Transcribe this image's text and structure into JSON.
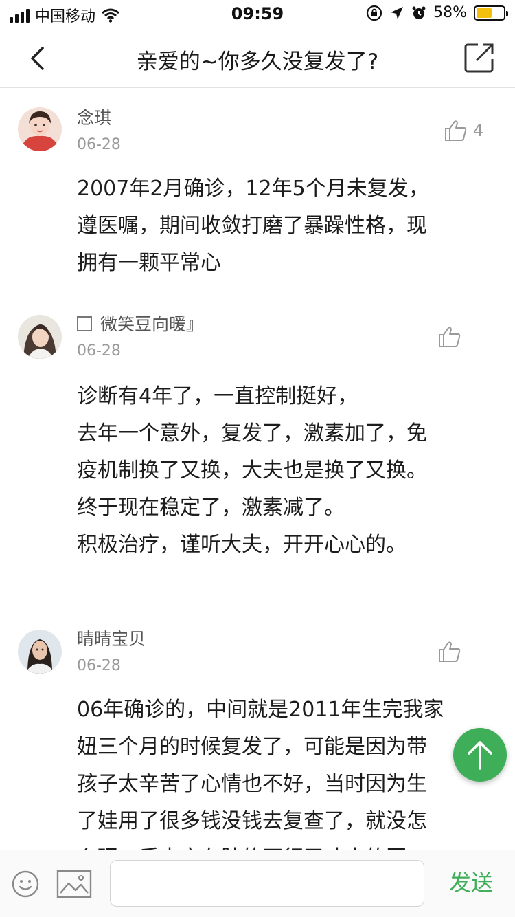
{
  "status_bar": {
    "carrier": "中国移动",
    "time": "09:59",
    "battery_percent": "58%",
    "battery_level": 0.58
  },
  "nav": {
    "title": "亲爱的~你多久没复发了?"
  },
  "comments": [
    {
      "author": "念琪",
      "date": "06-28",
      "likes": "4",
      "text": "2007年2月确诊，12年5个月未复发，\n遵医嘱，期间收敛打磨了暴躁性格，现\n拥有一颗平常心"
    },
    {
      "author": "微笑豆向暖』",
      "date": "06-28",
      "likes": "",
      "text": "诊断有4年了，一直控制挺好，\n去年一个意外，复发了，激素加了，免\n疫机制换了又换，大夫也是换了又换。\n终于现在稳定了，激素减了。\n积极治疗，谨听大夫，开开心心的。"
    },
    {
      "author": "晴晴宝贝",
      "date": "06-28",
      "likes": "",
      "text": "06年确诊的，中间就是2011年生完我家\n妞三个月的时候复发了，可能是因为带\n孩子太辛苦了心情也不好，当时因为生\n了娃用了很多钱没钱去复查了，就没怎\n么理，后来实在肿的不行了才去的医"
    }
  ],
  "input_bar": {
    "placeholder": "",
    "send_label": "发送"
  },
  "colors": {
    "accent": "#3fae59",
    "battery": "#f3c10d"
  },
  "icons": [
    "signal-icon",
    "wifi-icon",
    "lock-rotation-icon",
    "location-icon",
    "alarm-icon",
    "battery-icon",
    "back-icon",
    "share-icon",
    "thumbs-up-icon",
    "scroll-top-icon",
    "emoji-icon",
    "image-icon"
  ]
}
